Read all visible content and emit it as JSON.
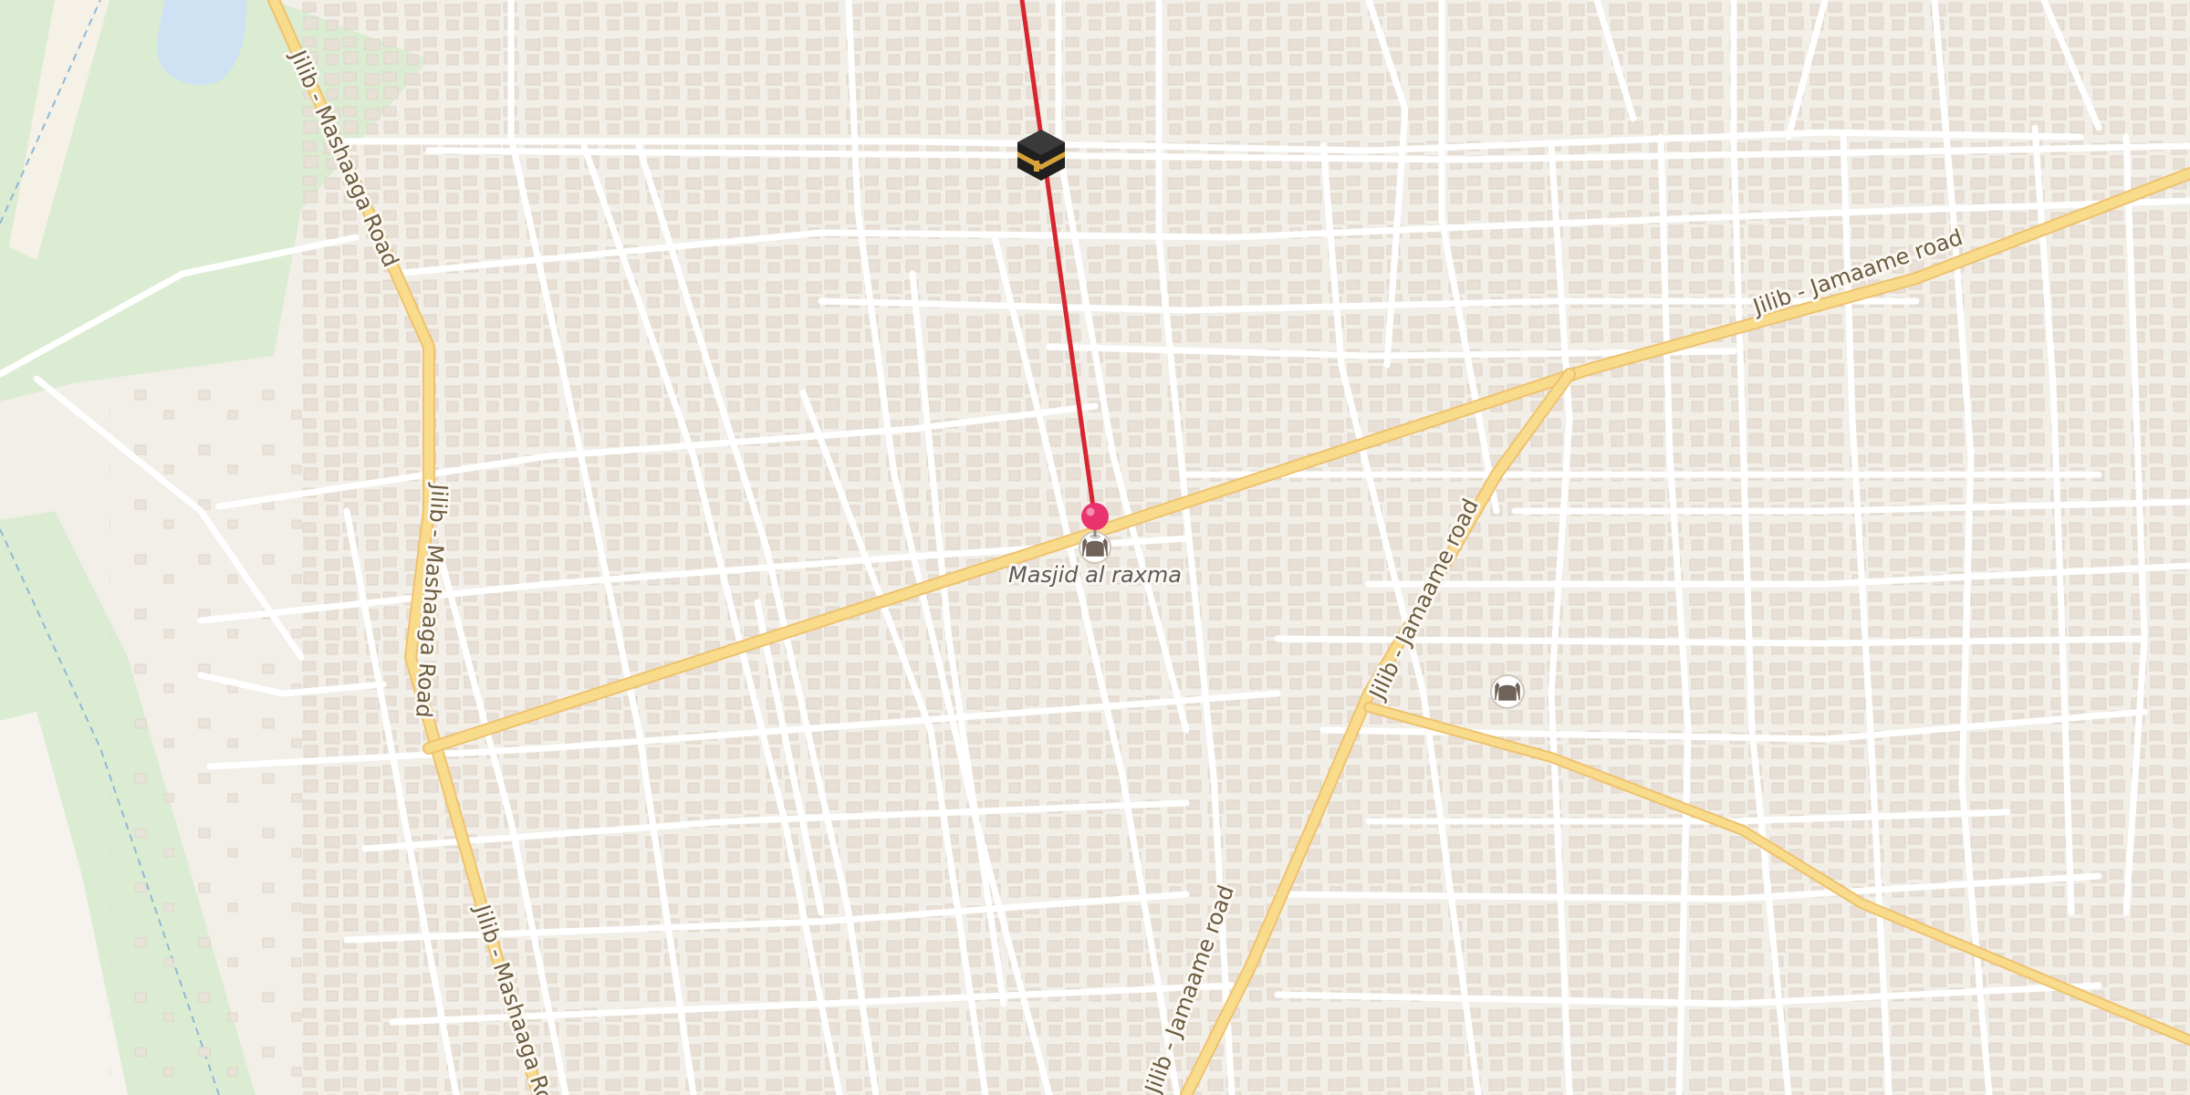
{
  "map": {
    "roads": {
      "west": "Jilib - Mashaaga Road",
      "jamaame": "Jilib - Jamaame road"
    },
    "places": {
      "mosque_name": "Masjid al raxma"
    },
    "markers": {
      "kaaba": "kaaba-icon",
      "pin": "location-pin-icon",
      "mosque": "mosque-icon"
    },
    "colors": {
      "land": "#f2efe9",
      "park": "#dcecd3",
      "water": "#cfe2f3",
      "main_road": "#f8dc8c",
      "main_road_casing": "#eec26f",
      "minor_road": "#ffffff",
      "building": "#e7dfd5",
      "qibla_line": "#d7262f",
      "pin": "#e8336f"
    }
  }
}
